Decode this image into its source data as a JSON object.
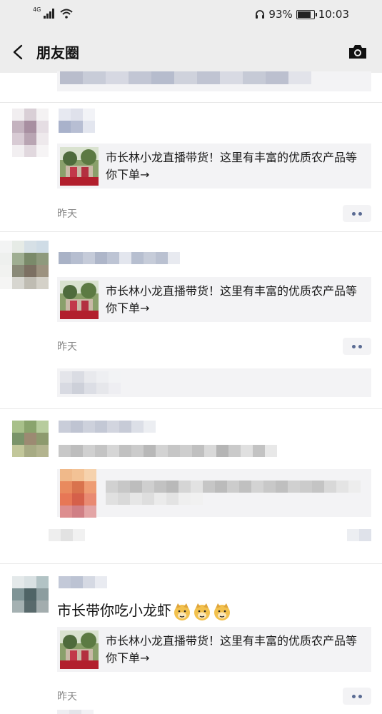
{
  "status_bar": {
    "network": "4G",
    "battery_text": "93%",
    "battery_level": 0.93,
    "time": "10:03"
  },
  "nav": {
    "title": "朋友圈",
    "back_icon": "chevron-left-icon",
    "camera_icon": "camera-icon"
  },
  "posts": [
    {
      "link_title": "市长林小龙直播带货！这里有丰富的优质农产品等你下单→",
      "time": "昨天"
    },
    {
      "link_title": "市长林小龙直播带货！这里有丰富的优质农产品等你下单→",
      "time": "昨天"
    },
    {
      "text": "市长带你吃小龙虾",
      "emoji": "doge-emoji",
      "link_title": "市长林小龙直播带货！这里有丰富的优质农产品等你下单→",
      "time": "昨天"
    }
  ],
  "colors": {
    "nav_bg": "#ededed",
    "link_card_bg": "#f3f3f5",
    "more_dot": "#5a6b93",
    "time_text": "#888888"
  }
}
